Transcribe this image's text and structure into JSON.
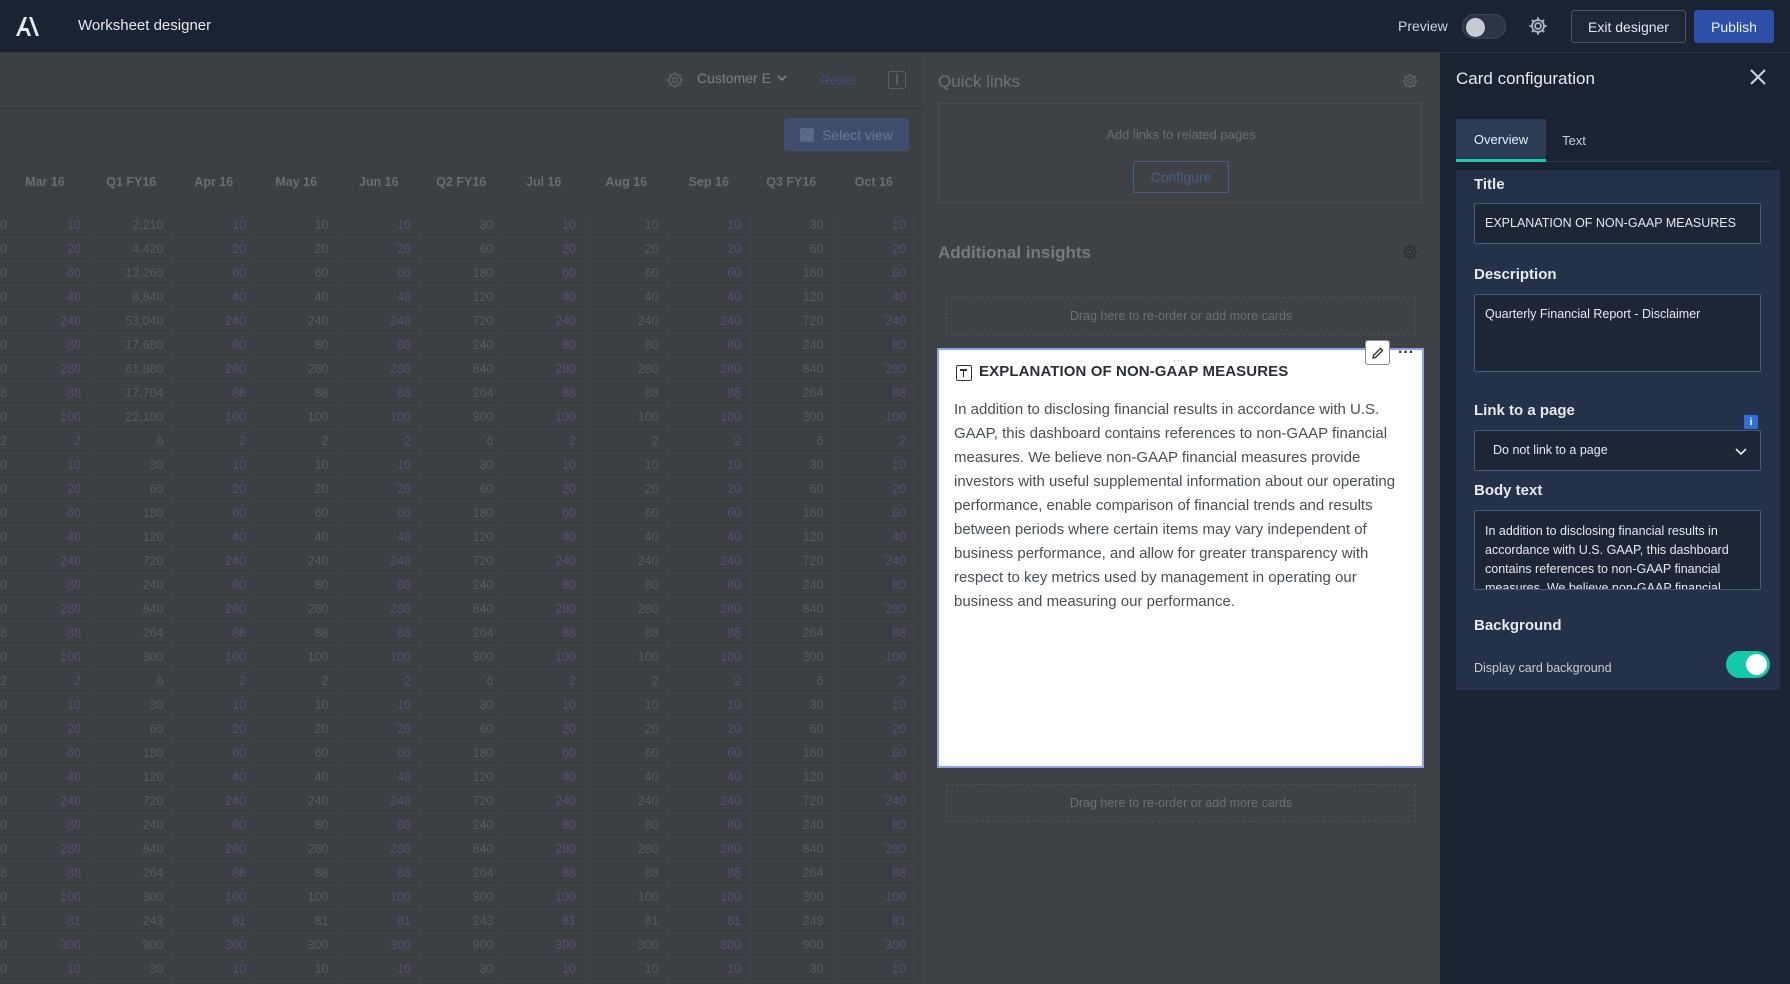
{
  "header": {
    "app_title": "Worksheet designer",
    "preview_label": "Preview",
    "preview_on": false,
    "exit_label": "Exit designer",
    "publish_label": "Publish"
  },
  "grid": {
    "customer_filter": "Customer E",
    "reset_label": "Reset",
    "select_view_label": "Select view",
    "columns": [
      "Mar 16",
      "Q1 FY16",
      "Apr 16",
      "May 16",
      "Jun 16",
      "Q2 FY16",
      "Jul 16",
      "Aug 16",
      "Sep 16",
      "Q3 FY16",
      "Oct 16"
    ],
    "rows": [
      {
        "lead": "0",
        "cells": [
          "10",
          "2,210",
          "10",
          "10",
          "10",
          "30",
          "10",
          "10",
          "10",
          "30",
          "10"
        ]
      },
      {
        "lead": "0",
        "cells": [
          "20",
          "4,420",
          "20",
          "20",
          "20",
          "60",
          "20",
          "20",
          "20",
          "60",
          "20"
        ]
      },
      {
        "lead": "0",
        "cells": [
          "60",
          "13,260",
          "60",
          "60",
          "60",
          "180",
          "60",
          "60",
          "60",
          "180",
          "60"
        ]
      },
      {
        "lead": "0",
        "cells": [
          "40",
          "8,840",
          "40",
          "40",
          "40",
          "120",
          "40",
          "40",
          "40",
          "120",
          "40"
        ]
      },
      {
        "lead": "0",
        "cells": [
          "240",
          "53,040",
          "240",
          "240",
          "240",
          "720",
          "240",
          "240",
          "240",
          "720",
          "240"
        ]
      },
      {
        "lead": "0",
        "cells": [
          "80",
          "17,680",
          "80",
          "80",
          "80",
          "240",
          "80",
          "80",
          "80",
          "240",
          "80"
        ]
      },
      {
        "lead": "0",
        "cells": [
          "280",
          "61,880",
          "280",
          "280",
          "280",
          "840",
          "280",
          "280",
          "280",
          "840",
          "280"
        ]
      },
      {
        "lead": "8",
        "cells": [
          "88",
          "17,704",
          "88",
          "88",
          "88",
          "264",
          "88",
          "88",
          "88",
          "264",
          "88"
        ]
      },
      {
        "lead": "0",
        "cells": [
          "100",
          "22,100",
          "100",
          "100",
          "100",
          "300",
          "100",
          "100",
          "100",
          "300",
          "100"
        ]
      },
      {
        "lead": "2",
        "cells": [
          "2",
          "6",
          "2",
          "2",
          "2",
          "6",
          "2",
          "2",
          "2",
          "6",
          "2"
        ]
      },
      {
        "lead": "0",
        "cells": [
          "10",
          "30",
          "10",
          "10",
          "10",
          "30",
          "10",
          "10",
          "10",
          "30",
          "10"
        ]
      },
      {
        "lead": "0",
        "cells": [
          "20",
          "60",
          "20",
          "20",
          "20",
          "60",
          "20",
          "20",
          "20",
          "60",
          "20"
        ]
      },
      {
        "lead": "0",
        "cells": [
          "60",
          "180",
          "60",
          "60",
          "60",
          "180",
          "60",
          "60",
          "60",
          "180",
          "60"
        ]
      },
      {
        "lead": "0",
        "cells": [
          "40",
          "120",
          "40",
          "40",
          "40",
          "120",
          "40",
          "40",
          "40",
          "120",
          "40"
        ]
      },
      {
        "lead": "0",
        "cells": [
          "240",
          "720",
          "240",
          "240",
          "240",
          "720",
          "240",
          "240",
          "240",
          "720",
          "240"
        ]
      },
      {
        "lead": "0",
        "cells": [
          "80",
          "240",
          "80",
          "80",
          "80",
          "240",
          "80",
          "80",
          "80",
          "240",
          "80"
        ]
      },
      {
        "lead": "0",
        "cells": [
          "280",
          "840",
          "280",
          "280",
          "280",
          "840",
          "280",
          "280",
          "280",
          "840",
          "280"
        ]
      },
      {
        "lead": "8",
        "cells": [
          "88",
          "264",
          "88",
          "88",
          "88",
          "264",
          "88",
          "88",
          "88",
          "264",
          "88"
        ]
      },
      {
        "lead": "0",
        "cells": [
          "100",
          "300",
          "100",
          "100",
          "100",
          "300",
          "100",
          "100",
          "100",
          "300",
          "100"
        ]
      },
      {
        "lead": "2",
        "cells": [
          "2",
          "6",
          "2",
          "2",
          "2",
          "6",
          "2",
          "2",
          "2",
          "6",
          "2"
        ]
      },
      {
        "lead": "0",
        "cells": [
          "10",
          "30",
          "10",
          "10",
          "10",
          "30",
          "10",
          "10",
          "10",
          "30",
          "10"
        ]
      },
      {
        "lead": "0",
        "cells": [
          "20",
          "60",
          "20",
          "20",
          "20",
          "60",
          "20",
          "20",
          "20",
          "60",
          "20"
        ]
      },
      {
        "lead": "0",
        "cells": [
          "60",
          "180",
          "60",
          "60",
          "60",
          "180",
          "60",
          "60",
          "60",
          "180",
          "60"
        ]
      },
      {
        "lead": "0",
        "cells": [
          "40",
          "120",
          "40",
          "40",
          "40",
          "120",
          "40",
          "40",
          "40",
          "120",
          "40"
        ]
      },
      {
        "lead": "0",
        "cells": [
          "240",
          "720",
          "240",
          "240",
          "240",
          "720",
          "240",
          "240",
          "240",
          "720",
          "240"
        ]
      },
      {
        "lead": "0",
        "cells": [
          "80",
          "240",
          "80",
          "80",
          "80",
          "240",
          "80",
          "80",
          "80",
          "240",
          "80"
        ]
      },
      {
        "lead": "0",
        "cells": [
          "280",
          "840",
          "280",
          "280",
          "280",
          "840",
          "280",
          "280",
          "280",
          "840",
          "280"
        ]
      },
      {
        "lead": "8",
        "cells": [
          "88",
          "264",
          "88",
          "88",
          "88",
          "264",
          "88",
          "88",
          "88",
          "264",
          "88"
        ]
      },
      {
        "lead": "0",
        "cells": [
          "100",
          "300",
          "100",
          "100",
          "100",
          "300",
          "100",
          "100",
          "100",
          "300",
          "100"
        ]
      },
      {
        "lead": "1",
        "cells": [
          "81",
          "243",
          "81",
          "81",
          "81",
          "243",
          "81",
          "81",
          "81",
          "243",
          "81"
        ]
      },
      {
        "lead": "0",
        "cells": [
          "300",
          "900",
          "300",
          "300",
          "300",
          "900",
          "300",
          "300",
          "300",
          "900",
          "300"
        ]
      },
      {
        "lead": "0",
        "cells": [
          "10",
          "30",
          "10",
          "10",
          "10",
          "30",
          "10",
          "10",
          "10",
          "30",
          "10"
        ]
      }
    ]
  },
  "quick_links": {
    "title": "Quick links",
    "hint": "Add links to related pages",
    "configure_label": "Configure"
  },
  "insights": {
    "title": "Additional insights",
    "dropzone_label": "Drag here to re-order or add more cards",
    "card": {
      "title": "EXPLANATION OF NON-GAAP MEASURES",
      "body": "In addition to disclosing financial results in accordance with U.S. GAAP, this dashboard contains references to non-GAAP financial measures. We believe non-GAAP financial measures provide investors with useful supplemental information about our operating performance, enable comparison of financial trends and results between periods where certain items may vary independent of business performance, and allow for greater transparency with respect to key metrics used by management in operating our business and measuring our performance."
    }
  },
  "config_panel": {
    "title": "Card configuration",
    "tabs": [
      {
        "label": "Overview"
      },
      {
        "label": "Text"
      }
    ],
    "title_label": "Title",
    "title_value": "EXPLANATION OF NON-GAAP MEASURES",
    "description_label": "Description",
    "description_value": "Quarterly Financial Report - Disclaimer",
    "link_label": "Link to a page",
    "link_value": "Do not link to a page",
    "body_label": "Body text",
    "body_value": "In addition to disclosing financial results in accordance with U.S. GAAP, this dashboard contains references to non-GAAP financial measures. We believe non-GAAP financial",
    "background_label": "Background",
    "background_sub": "Display card background",
    "background_on": true
  },
  "colors": {
    "accent": "#14c8a8",
    "publish": "#2e4fa8",
    "card_border": "#8aa4e5"
  }
}
